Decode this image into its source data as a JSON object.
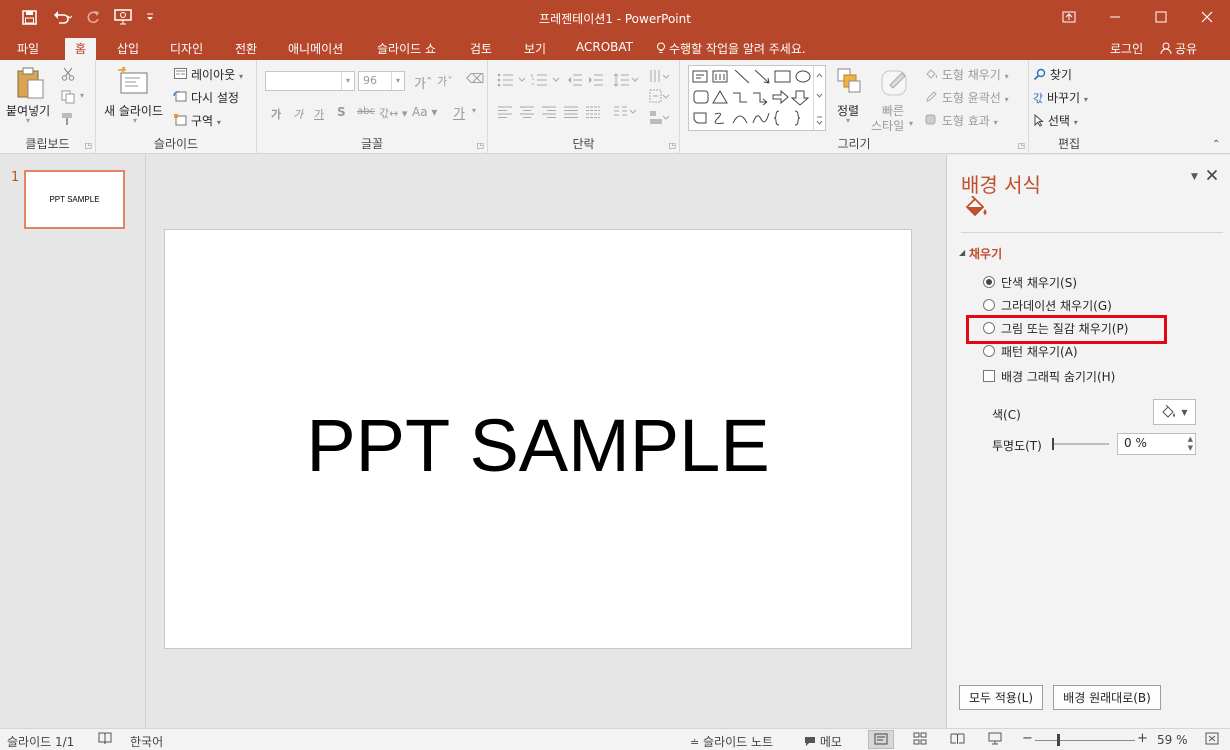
{
  "app": {
    "title": "프레젠테이션1 - PowerPoint"
  },
  "quick_access": {
    "icons": [
      "save-icon",
      "undo-icon",
      "redo-icon",
      "present-icon",
      "customize-icon"
    ]
  },
  "window": {
    "icons": [
      "ribbon-display-icon",
      "minimize-icon",
      "maximize-icon",
      "close-icon"
    ]
  },
  "tabs": {
    "file": "파일",
    "home": "홈",
    "insert": "삽입",
    "design": "디자인",
    "transitions": "전환",
    "animations": "애니메이션",
    "slideshow": "슬라이드 쇼",
    "review": "검토",
    "view": "보기",
    "acrobat": "ACROBAT",
    "tellme": "수행할 작업을 알려 주세요.",
    "signin": "로그인",
    "share": "공유"
  },
  "ribbon": {
    "clipboard": {
      "paste": "붙여넣기",
      "label": "클립보드"
    },
    "slides": {
      "new_slide": "새 슬라이드",
      "layout": "레이아웃",
      "reset": "다시 설정",
      "section": "구역",
      "label": "슬라이드"
    },
    "font": {
      "size": "96",
      "label": "글꼴"
    },
    "paragraph": {
      "label": "단락"
    },
    "drawing": {
      "arrange": "정렬",
      "quick_styles_1": "빠른",
      "quick_styles_2": "스타일",
      "shape_fill": "도형 채우기",
      "shape_outline": "도형 윤곽선",
      "shape_effects": "도형 효과",
      "label": "그리기"
    },
    "editing": {
      "find": "찾기",
      "replace": "바꾸기",
      "select": "선택",
      "label": "편집"
    }
  },
  "thumbnails": {
    "number": "1",
    "text": "PPT SAMPLE"
  },
  "slide": {
    "text": "PPT SAMPLE"
  },
  "format_pane": {
    "title": "배경 서식",
    "section": "채우기",
    "solid_fill": "단색 채우기(S)",
    "gradient_fill": "그라데이션 채우기(G)",
    "picture_fill": "그림 또는 질감 채우기(P)",
    "pattern_fill": "패턴 채우기(A)",
    "hide_graphics": "배경 그래픽 숨기기(H)",
    "color_label": "색(C)",
    "transparency_label": "투명도(T)",
    "transparency_value": "0 %",
    "apply_all": "모두 적용(L)",
    "reset_background": "배경 원래대로(B)"
  },
  "status": {
    "slide_count": "슬라이드 1/1",
    "language": "한국어",
    "notes": "슬라이드 노트",
    "comments": "메모",
    "zoom": "59 %"
  },
  "colors": {
    "accent": "#b7472a",
    "pane_title": "#c0502d",
    "highlight": "#e30613"
  }
}
